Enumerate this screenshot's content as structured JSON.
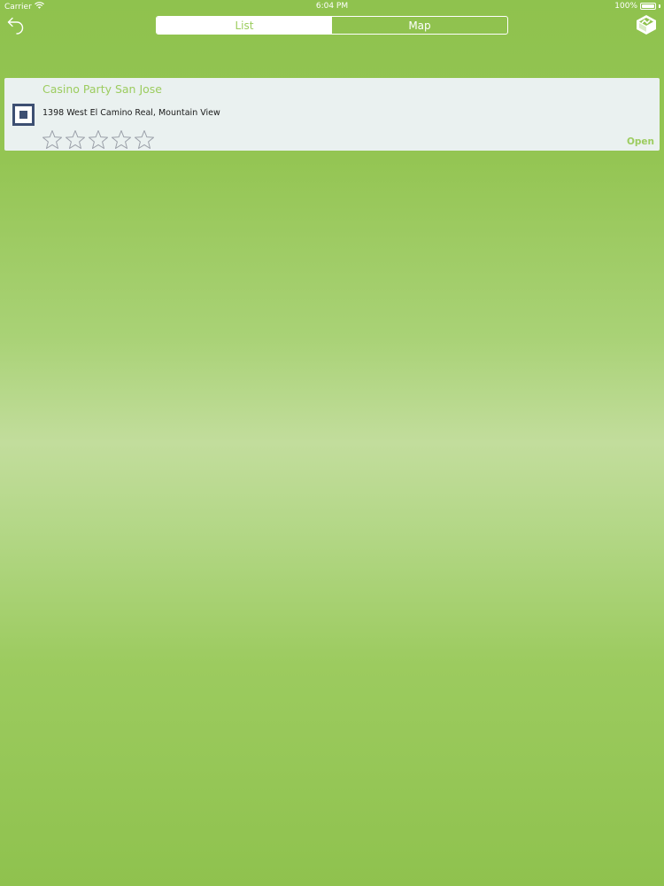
{
  "status_bar": {
    "carrier": "Carrier",
    "time": "6:04 PM",
    "battery": "100%",
    "battery_level": 1.0
  },
  "nav": {
    "back_icon": "back-arrow-icon",
    "segments": [
      {
        "label": "List",
        "selected": true
      },
      {
        "label": "Map",
        "selected": false
      }
    ],
    "logo_icon": "app-logo-icon"
  },
  "colors": {
    "accent_green": "#9ccc5f",
    "card_background": "#eaf1f0",
    "icon_navy": "#3d4f72"
  },
  "listings": [
    {
      "title": "Casino Party San Jose",
      "address": "1398 West El Camino Real, Mountain View",
      "rating": 0,
      "rating_max": 5,
      "status": "Open",
      "icon": "venue-square-icon"
    }
  ]
}
